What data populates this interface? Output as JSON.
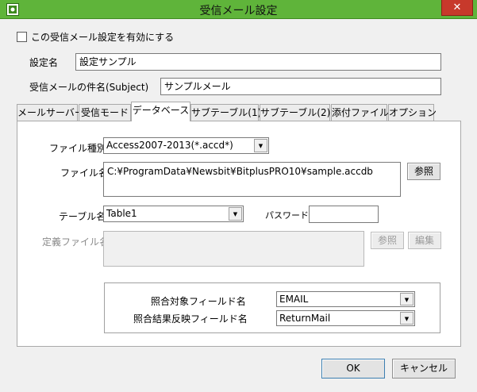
{
  "window": {
    "title": "受信メール設定",
    "close_glyph": "✕",
    "icon": "app-gear-icon"
  },
  "enable_checkbox": {
    "label": "この受信メール設定を有効にする",
    "checked": false
  },
  "setting_name": {
    "label": "設定名",
    "value": "設定サンプル"
  },
  "subject": {
    "label": "受信メールの件名(Subject)",
    "value": "サンプルメール"
  },
  "tabs": [
    {
      "label": "メールサーバー"
    },
    {
      "label": "受信モード"
    },
    {
      "label": "データベース"
    },
    {
      "label": "サブテーブル(1)"
    },
    {
      "label": "サブテーブル(2)"
    },
    {
      "label": "添付ファイル"
    },
    {
      "label": "オプション"
    }
  ],
  "database": {
    "file_type": {
      "label": "ファイル種別",
      "value": "Access2007-2013(*.accd*)"
    },
    "file_name": {
      "label": "ファイル名",
      "value": "C:¥ProgramData¥Newsbit¥BitplusPRO10¥sample.accdb"
    },
    "browse_button": "参照",
    "table_name": {
      "label": "テーブル名",
      "value": "Table1"
    },
    "password": {
      "label": "パスワード",
      "value": ""
    },
    "definition_file": {
      "label": "定義ファイル名",
      "value": ""
    },
    "def_browse_button": "参照",
    "def_edit_button": "編集",
    "match_field": {
      "label": "照合対象フィールド名",
      "value": "EMAIL"
    },
    "result_field": {
      "label": "照合結果反映フィールド名",
      "value": "ReturnMail"
    }
  },
  "footer": {
    "ok": "OK",
    "cancel": "キャンセル"
  },
  "colors": {
    "titlebar": "#5fb43a",
    "close": "#c7392b"
  }
}
